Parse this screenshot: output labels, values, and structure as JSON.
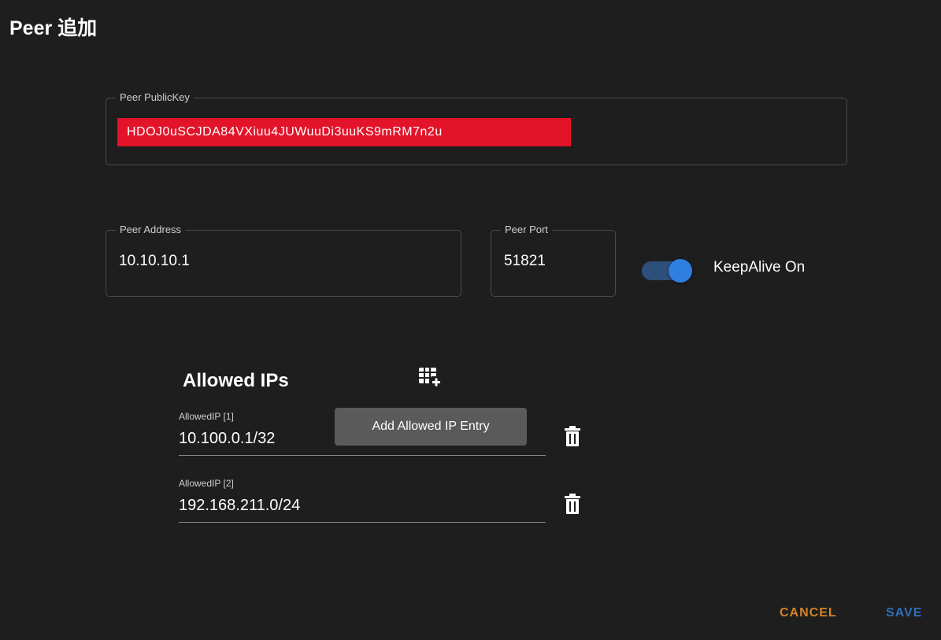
{
  "dialog": {
    "title": "Peer 追加"
  },
  "public_key": {
    "label": "Peer PublicKey",
    "value": "HDOJ0uSCJDA84VXiuu4JUWuuDi3uuKS9mRM7n2u"
  },
  "address": {
    "label": "Peer Address",
    "value": "10.10.10.1"
  },
  "port": {
    "label": "Peer Port",
    "value": "51821"
  },
  "keepalive": {
    "label": "KeepAlive On",
    "on": true,
    "accent_color": "#2f7fe0"
  },
  "allowed_ips": {
    "title": "Allowed IPs",
    "add_icon": "grid-plus-icon",
    "tooltip": "Add Allowed IP Entry",
    "entries": [
      {
        "label": "AllowedIP [1]",
        "value": "10.100.0.1/32"
      },
      {
        "label": "AllowedIP [2]",
        "value": "192.168.211.0/24"
      }
    ]
  },
  "actions": {
    "cancel_label": "CANCEL",
    "save_label": "SAVE",
    "cancel_color": "#d4832a",
    "save_color": "#2e6fb8"
  }
}
